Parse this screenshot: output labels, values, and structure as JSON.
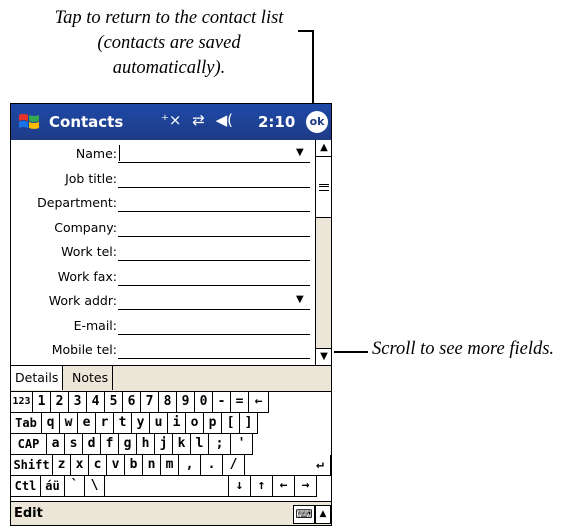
{
  "callouts": {
    "top": "Tap to return to the contact list (contacts are saved automatically).",
    "right": "Scroll to see more fields."
  },
  "navbar": {
    "title": "Contacts",
    "icons": [
      "⁺×",
      "⇄",
      "◀("
    ],
    "time": "2:10",
    "ok_label": "ok"
  },
  "form": {
    "fields": [
      {
        "label": "Name:",
        "dropdown": "▼"
      },
      {
        "label": "Job title:"
      },
      {
        "label": "Department:"
      },
      {
        "label": "Company:"
      },
      {
        "label": "Work tel:"
      },
      {
        "label": "Work fax:"
      },
      {
        "label": "Work addr:",
        "dropdown": "▼"
      },
      {
        "label": "E-mail:"
      },
      {
        "label": "Mobile tel:"
      }
    ]
  },
  "scrollbar": {
    "up": "▲",
    "down": "▼"
  },
  "tabs": [
    "Details",
    "Notes"
  ],
  "keyboard": {
    "rows": [
      [
        "123",
        "1",
        "2",
        "3",
        "4",
        "5",
        "6",
        "7",
        "8",
        "9",
        "0",
        "-",
        "=",
        "←"
      ],
      [
        "Tab",
        "q",
        "w",
        "e",
        "r",
        "t",
        "y",
        "u",
        "i",
        "o",
        "p",
        "[",
        "]"
      ],
      [
        "CAP",
        "a",
        "s",
        "d",
        "f",
        "g",
        "h",
        "j",
        "k",
        "l",
        ";",
        "'"
      ],
      [
        "Shift",
        "z",
        "x",
        "c",
        "v",
        "b",
        "n",
        "m",
        ",",
        ".",
        "/",
        "↵"
      ],
      [
        "Ctl",
        "áü",
        "`",
        "\\",
        "",
        "↓",
        "↑",
        "←",
        "→"
      ]
    ]
  },
  "menubar": {
    "edit": "Edit",
    "keyboard_icon": "⌨",
    "sip_arrow": "▲"
  }
}
